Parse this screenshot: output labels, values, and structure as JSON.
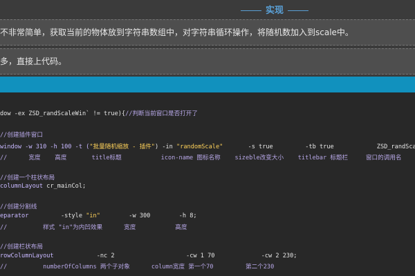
{
  "heading": "实现",
  "notes": [
    "不非常简单，获取当前的物体放到字符串数组中，对字符串循环操作，将随机数加入到scale中。",
    "多，直接上代码。"
  ],
  "code": {
    "l1a": "dow -ex ZSD_randScaleWin` != true){",
    "l1b": "//判断当前窗口是否打开了",
    "l2": "//创建插件窗口",
    "l3a": "window -w 310 -h 100 -t (",
    "l3b": "\"批量随机缩放 - 插件\"",
    "l3c": ") -in ",
    "l3d": "\"randomScale\"",
    "l3e": "       -s true         -tb true            ZSD_randScaleWin;",
    "l4": "//      宽度    高度       title标题           icon-name 图标名称    sizeble改变大小    titlebar 标题栏     窗口的调用名",
    "l5": "//创建一个柱状布局",
    "l6a": "columnLayout",
    "l6b": " cr_mainCol;",
    "l7": "//创建分割线",
    "l8a": "eparator",
    "l8b": "         -style ",
    "l8c": "\"in\"",
    "l8d": "        -w 300        -h 8;",
    "l9": "//          样式 \"in\"为内凹效果      宽度           高度",
    "l10": "//创建栏状布局",
    "l11a": "rowColumnLayout",
    "l11b": "            -nc 2                    -cw 1 70             -cw 2 230;",
    "l12": "//          numberOfColumns 两个子对象      column宽度 第一个70         第二个230"
  }
}
